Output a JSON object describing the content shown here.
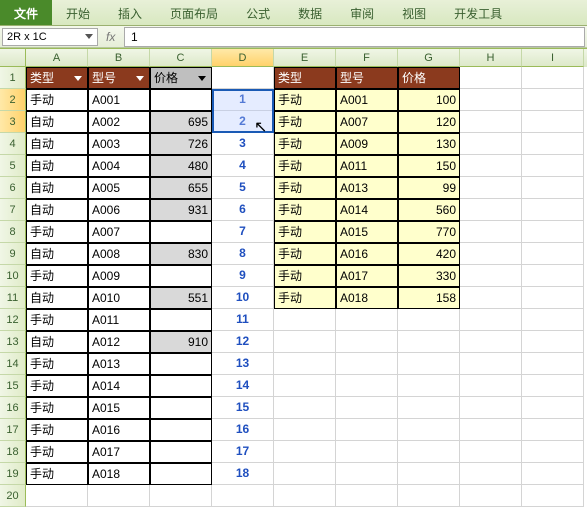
{
  "ribbon": {
    "tabs": [
      "文件",
      "开始",
      "插入",
      "页面布局",
      "公式",
      "数据",
      "审阅",
      "视图",
      "开发工具"
    ]
  },
  "namebox": "2R x 1C",
  "formula": "1",
  "cols": [
    "A",
    "B",
    "C",
    "D",
    "E",
    "F",
    "G",
    "H",
    "I"
  ],
  "headersA": {
    "type": "类型",
    "model": "型号",
    "price": "价格"
  },
  "tableA": [
    {
      "t": "手动",
      "m": "A001",
      "p": ""
    },
    {
      "t": "自动",
      "m": "A002",
      "p": "695"
    },
    {
      "t": "自动",
      "m": "A003",
      "p": "726"
    },
    {
      "t": "自动",
      "m": "A004",
      "p": "480"
    },
    {
      "t": "自动",
      "m": "A005",
      "p": "655"
    },
    {
      "t": "自动",
      "m": "A006",
      "p": "931"
    },
    {
      "t": "手动",
      "m": "A007",
      "p": ""
    },
    {
      "t": "自动",
      "m": "A008",
      "p": "830"
    },
    {
      "t": "手动",
      "m": "A009",
      "p": ""
    },
    {
      "t": "自动",
      "m": "A010",
      "p": "551"
    },
    {
      "t": "手动",
      "m": "A011",
      "p": ""
    },
    {
      "t": "自动",
      "m": "A012",
      "p": "910"
    },
    {
      "t": "手动",
      "m": "A013",
      "p": ""
    },
    {
      "t": "手动",
      "m": "A014",
      "p": ""
    },
    {
      "t": "手动",
      "m": "A015",
      "p": ""
    },
    {
      "t": "手动",
      "m": "A016",
      "p": ""
    },
    {
      "t": "手动",
      "m": "A017",
      "p": ""
    },
    {
      "t": "手动",
      "m": "A018",
      "p": ""
    }
  ],
  "seq": [
    1,
    2,
    3,
    4,
    5,
    6,
    7,
    8,
    9,
    10,
    11,
    12,
    13,
    14,
    15,
    16,
    17,
    18
  ],
  "headersE": {
    "type": "类型",
    "model": "型号",
    "price": "价格"
  },
  "tableE": [
    {
      "t": "手动",
      "m": "A001",
      "p": "100"
    },
    {
      "t": "手动",
      "m": "A007",
      "p": "120"
    },
    {
      "t": "手动",
      "m": "A009",
      "p": "130"
    },
    {
      "t": "手动",
      "m": "A011",
      "p": "150"
    },
    {
      "t": "手动",
      "m": "A013",
      "p": "99"
    },
    {
      "t": "手动",
      "m": "A014",
      "p": "560"
    },
    {
      "t": "手动",
      "m": "A015",
      "p": "770"
    },
    {
      "t": "手动",
      "m": "A016",
      "p": "420"
    },
    {
      "t": "手动",
      "m": "A017",
      "p": "330"
    },
    {
      "t": "手动",
      "m": "A018",
      "p": "158"
    }
  ],
  "cursor_glyph": "↖",
  "chart_data": {
    "type": "table",
    "title": "",
    "left_table": {
      "columns": [
        "类型",
        "型号",
        "价格"
      ],
      "rows": [
        [
          "手动",
          "A001",
          null
        ],
        [
          "自动",
          "A002",
          695
        ],
        [
          "自动",
          "A003",
          726
        ],
        [
          "自动",
          "A004",
          480
        ],
        [
          "自动",
          "A005",
          655
        ],
        [
          "自动",
          "A006",
          931
        ],
        [
          "手动",
          "A007",
          null
        ],
        [
          "自动",
          "A008",
          830
        ],
        [
          "手动",
          "A009",
          null
        ],
        [
          "自动",
          "A010",
          551
        ],
        [
          "手动",
          "A011",
          null
        ],
        [
          "自动",
          "A012",
          910
        ],
        [
          "手动",
          "A013",
          null
        ],
        [
          "手动",
          "A014",
          null
        ],
        [
          "手动",
          "A015",
          null
        ],
        [
          "手动",
          "A016",
          null
        ],
        [
          "手动",
          "A017",
          null
        ],
        [
          "手动",
          "A018",
          null
        ]
      ]
    },
    "right_table": {
      "columns": [
        "类型",
        "型号",
        "价格"
      ],
      "rows": [
        [
          "手动",
          "A001",
          100
        ],
        [
          "手动",
          "A007",
          120
        ],
        [
          "手动",
          "A009",
          130
        ],
        [
          "手动",
          "A011",
          150
        ],
        [
          "手动",
          "A013",
          99
        ],
        [
          "手动",
          "A014",
          560
        ],
        [
          "手动",
          "A015",
          770
        ],
        [
          "手动",
          "A016",
          420
        ],
        [
          "手动",
          "A017",
          330
        ],
        [
          "手动",
          "A018",
          158
        ]
      ]
    }
  }
}
